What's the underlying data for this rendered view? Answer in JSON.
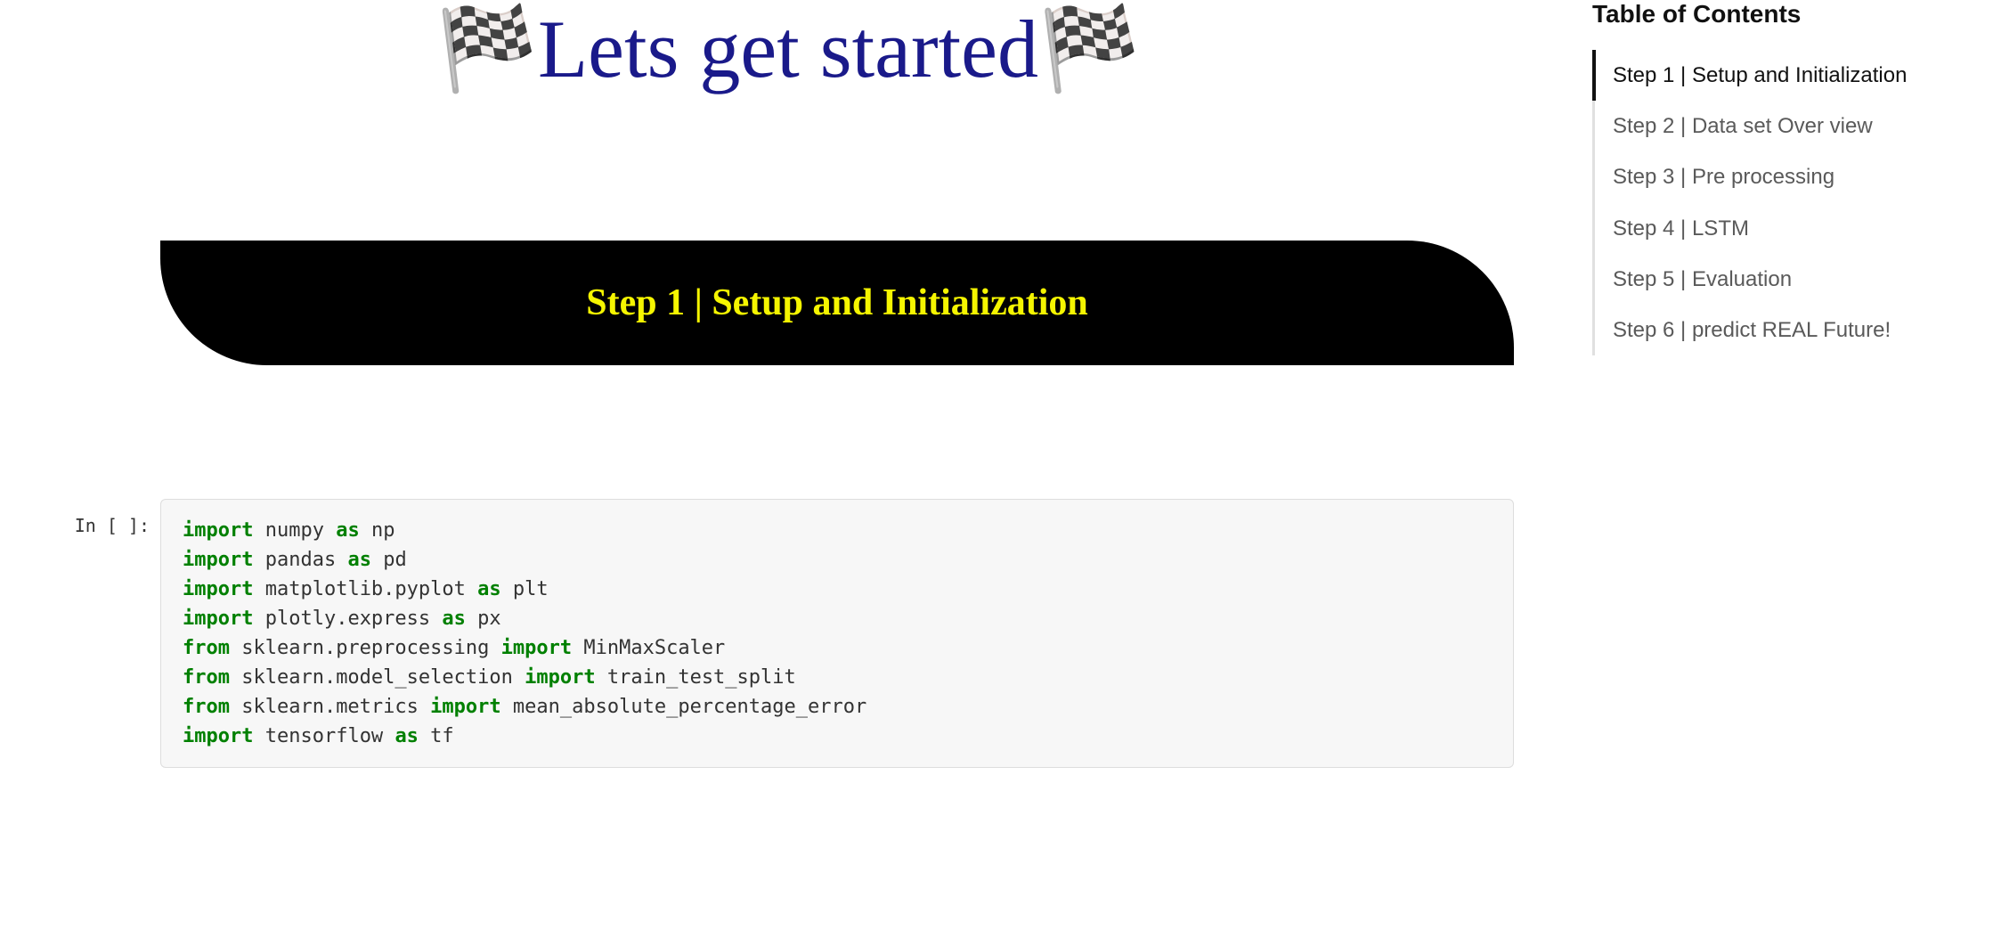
{
  "header": {
    "title": "🏁Lets get started🏁"
  },
  "banner": {
    "label": "Step 1 | Setup and Initialization"
  },
  "cell": {
    "prompt": "In [ ]:",
    "lines": [
      {
        "t": "kw",
        "v": "import"
      },
      {
        "t": "sp",
        "v": " numpy "
      },
      {
        "t": "kw2",
        "v": "as"
      },
      {
        "t": "sp",
        "v": " np"
      },
      {
        "t": "nl"
      },
      {
        "t": "kw",
        "v": "import"
      },
      {
        "t": "sp",
        "v": " pandas "
      },
      {
        "t": "kw2",
        "v": "as"
      },
      {
        "t": "sp",
        "v": " pd"
      },
      {
        "t": "nl"
      },
      {
        "t": "kw",
        "v": "import"
      },
      {
        "t": "sp",
        "v": " matplotlib.pyplot "
      },
      {
        "t": "kw2",
        "v": "as"
      },
      {
        "t": "sp",
        "v": " plt"
      },
      {
        "t": "nl"
      },
      {
        "t": "kw",
        "v": "import"
      },
      {
        "t": "sp",
        "v": " plotly.express "
      },
      {
        "t": "kw2",
        "v": "as"
      },
      {
        "t": "sp",
        "v": " px"
      },
      {
        "t": "nl"
      },
      {
        "t": "kw",
        "v": "from"
      },
      {
        "t": "sp",
        "v": " sklearn.preprocessing "
      },
      {
        "t": "kw2",
        "v": "import"
      },
      {
        "t": "sp",
        "v": " MinMaxScaler"
      },
      {
        "t": "nl"
      },
      {
        "t": "kw",
        "v": "from"
      },
      {
        "t": "sp",
        "v": " sklearn.model_selection "
      },
      {
        "t": "kw2",
        "v": "import"
      },
      {
        "t": "sp",
        "v": " train_test_split"
      },
      {
        "t": "nl"
      },
      {
        "t": "kw",
        "v": "from"
      },
      {
        "t": "sp",
        "v": " sklearn.metrics "
      },
      {
        "t": "kw2",
        "v": "import"
      },
      {
        "t": "sp",
        "v": " mean_absolute_percentage_error"
      },
      {
        "t": "nl"
      },
      {
        "t": "kw",
        "v": "import"
      },
      {
        "t": "sp",
        "v": " tensorflow "
      },
      {
        "t": "kw2",
        "v": "as"
      },
      {
        "t": "sp",
        "v": " tf"
      }
    ]
  },
  "toc": {
    "title": "Table of Contents",
    "items": [
      {
        "label": "Step 1 | Setup and Initialization",
        "active": true
      },
      {
        "label": "Step 2 | Data set Over view",
        "active": false
      },
      {
        "label": "Step 3 | Pre processing",
        "active": false
      },
      {
        "label": "Step 4 | LSTM",
        "active": false
      },
      {
        "label": "Step 5 | Evaluation",
        "active": false
      },
      {
        "label": "Step 6 | predict REAL Future!",
        "active": false
      }
    ]
  }
}
